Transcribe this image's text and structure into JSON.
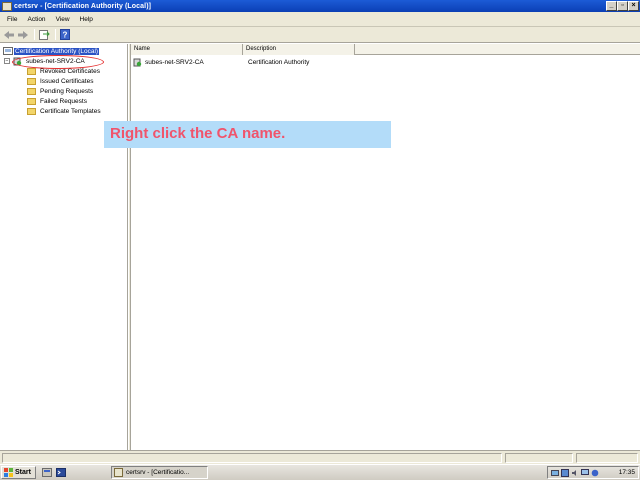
{
  "window": {
    "title": "certsrv - [Certification Authority (Local)]"
  },
  "menu": [
    {
      "label": "File"
    },
    {
      "label": "Action"
    },
    {
      "label": "View"
    },
    {
      "label": "Help"
    }
  ],
  "toolbar": {
    "icons": [
      "back-icon",
      "forward-icon",
      "export-list-icon",
      "help-icon"
    ]
  },
  "tree": {
    "root": "Certification Authority (Local)",
    "ca_node": "subes-net-SRV2-CA",
    "folders": [
      "Revoked Certificates",
      "Issued Certificates",
      "Pending Requests",
      "Failed Requests",
      "Certificate Templates"
    ]
  },
  "list": {
    "columns": [
      "Name",
      "Description"
    ],
    "rows": [
      {
        "name": "subes-net-SRV2-CA",
        "description": "Certification Authority"
      }
    ]
  },
  "callout": {
    "text": "Right click the CA name."
  },
  "taskbar": {
    "start_label": "Start",
    "task_label": "certsrv - [Certificatio...",
    "clock": "17:35"
  },
  "colors": {
    "titlebar": "#0b3fb5",
    "callout_bg": "#b3dcf9",
    "callout_text": "#f0546c",
    "highlight": "#e53030"
  }
}
